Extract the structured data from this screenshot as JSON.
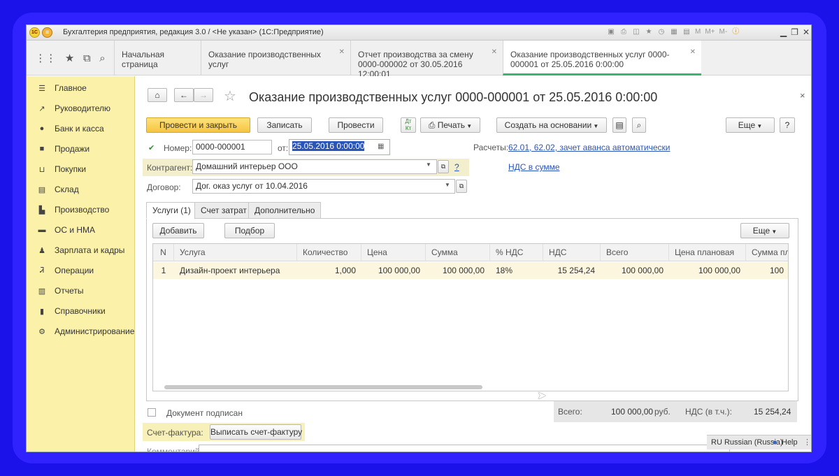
{
  "window": {
    "title": "Бухгалтерия предприятия, редакция 3.0 / <Не указан>  (1С:Предприятие)",
    "toolbar_text": [
      "M",
      "M+",
      "M-"
    ]
  },
  "nav_tabs": [
    {
      "label": "Начальная страница"
    },
    {
      "label": "Оказание производственных услуг"
    },
    {
      "label": "Отчет производства за смену 0000-000002 от 30.05.2016 12:00:01"
    },
    {
      "label": "Оказание производственных услуг 0000-000001 от 25.05.2016 0:00:00"
    }
  ],
  "sidebar": {
    "items": [
      {
        "label": "Главное",
        "icon": "menu-icon"
      },
      {
        "label": "Руководителю",
        "icon": "chart-icon"
      },
      {
        "label": "Банк и касса",
        "icon": "bank-icon"
      },
      {
        "label": "Продажи",
        "icon": "bag-icon"
      },
      {
        "label": "Покупки",
        "icon": "cart-icon"
      },
      {
        "label": "Склад",
        "icon": "warehouse-icon"
      },
      {
        "label": "Производство",
        "icon": "factory-icon"
      },
      {
        "label": "ОС и НМА",
        "icon": "truck-icon"
      },
      {
        "label": "Зарплата и кадры",
        "icon": "person-icon"
      },
      {
        "label": "Операции",
        "icon": "operations-icon"
      },
      {
        "label": "Отчеты",
        "icon": "report-icon"
      },
      {
        "label": "Справочники",
        "icon": "book-icon"
      },
      {
        "label": "Администрирование",
        "icon": "gear-icon"
      }
    ]
  },
  "doc": {
    "title": "Оказание производственных услуг 0000-000001 от 25.05.2016 0:00:00",
    "buttons": {
      "post_close": "Провести и закрыть",
      "save": "Записать",
      "post": "Провести",
      "print": "Печать",
      "create_based": "Создать на основании",
      "more": "Еще",
      "help": "?"
    },
    "number_label": "Номер:",
    "number_value": "0000-000001",
    "from_label": "от:",
    "date_value": "25.05.2016  0:00:00",
    "settlements_label": "Расчеты:",
    "settlements_link": "62.01, 62.02, зачет аванса автоматически",
    "vat_link": "НДС в сумме",
    "counterparty_label": "Контрагент:",
    "counterparty_value": "Домашний интерьер ООО",
    "contract_label": "Договор:",
    "contract_value": "Дог. оказ услуг от 10.04.2016",
    "question": "?"
  },
  "subtabs": [
    {
      "label": "Услуги (1)"
    },
    {
      "label": "Счет затрат"
    },
    {
      "label": "Дополнительно"
    }
  ],
  "grid_toolbar": {
    "add": "Добавить",
    "pick": "Подбор",
    "more": "Еще"
  },
  "table": {
    "columns": [
      "N",
      "Услуга",
      "Количество",
      "Цена",
      "Сумма",
      "% НДС",
      "НДС",
      "Всего",
      "Цена плановая",
      "Сумма пла"
    ],
    "rows": [
      [
        "1",
        "Дизайн-проект интерьера",
        "1,000",
        "100 000,00",
        "100 000,00",
        "18%",
        "15 254,24",
        "100 000,00",
        "100 000,00",
        "100"
      ]
    ]
  },
  "footer": {
    "signed_label": "Документ подписан",
    "invoice_label": "Счет-фактура:",
    "invoice_button": "Выписать счет-фактуру",
    "comment_label": "Комментарий:",
    "total_label": "Всего:",
    "total_value": "100 000,00",
    "currency": "руб.",
    "vat_label": "НДС (в т.ч.):",
    "vat_value": "15 254,24"
  },
  "statusbar": {
    "language": "RU Russian (Russia)",
    "help": "Help"
  },
  "colors": {
    "accent": "#3cb371",
    "sidebar_bg": "#fbf1a8",
    "primary_button": "#f5c542",
    "link": "#2a55b8"
  }
}
